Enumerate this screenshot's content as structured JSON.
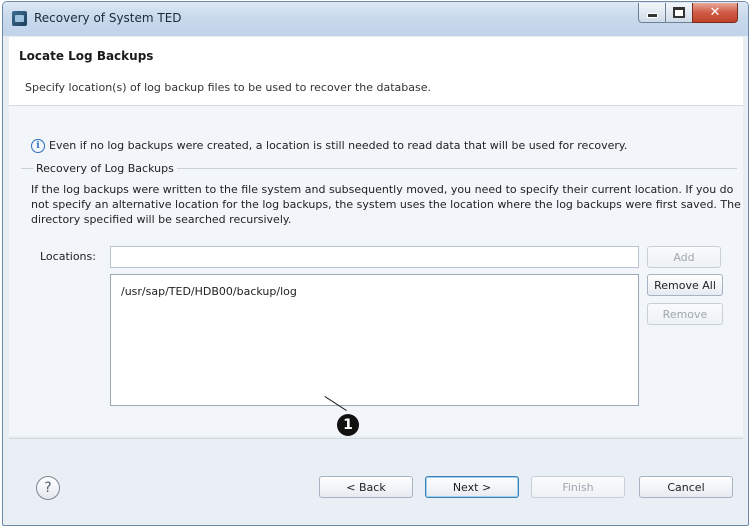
{
  "window": {
    "title": "Recovery of System TED"
  },
  "header": {
    "title": "Locate Log Backups",
    "subtitle": "Specify location(s) of log backup files to be used to recover the database."
  },
  "info": {
    "icon": "info-icon",
    "text": "Even if no log backups were created, a location is still needed to read data that will be used for recovery."
  },
  "group": {
    "label": "Recovery of Log Backups",
    "description": "If the log backups were written to the file system and subsequently moved, you need to specify their current location. If you do not specify an alternative location for the log backups, the system uses the location where the log backups were first saved. The directory specified will be searched recursively."
  },
  "locations": {
    "label": "Locations:",
    "value": "",
    "items": [
      "/usr/sap/TED/HDB00/backup/log"
    ]
  },
  "buttons": {
    "add": "Add",
    "remove_all": "Remove All",
    "remove": "Remove"
  },
  "callout": "1",
  "footer": {
    "help": "?",
    "back": "< Back",
    "next": "Next >",
    "finish": "Finish",
    "cancel": "Cancel"
  },
  "colors": {
    "window_border": "#6f8aa8",
    "close_button": "#c0412a",
    "focus_border": "#3c7fb1"
  }
}
